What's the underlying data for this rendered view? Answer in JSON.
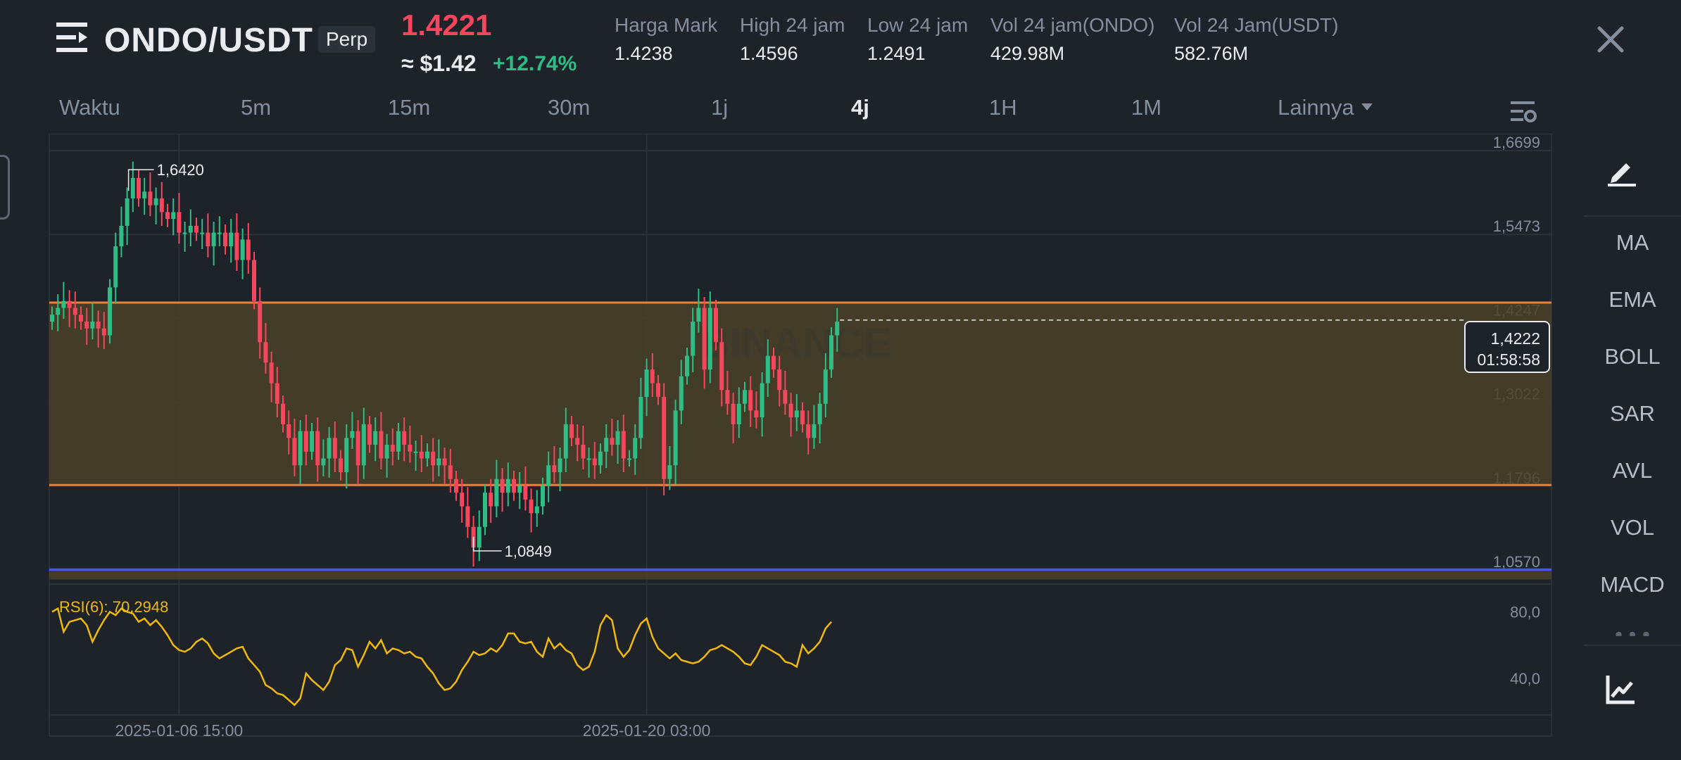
{
  "header": {
    "pair": "ONDO/USDT",
    "badge": "Perp",
    "last_price": "1.4221",
    "usd_price": "≈ $1.42",
    "change": "+12.74%",
    "stats": [
      {
        "label": "Harga Mark",
        "value": "1.4238"
      },
      {
        "label": "High 24 jam",
        "value": "1.4596"
      },
      {
        "label": "Low 24 jam",
        "value": "1.2491"
      },
      {
        "label": "Vol 24 jam(ONDO)",
        "value": "429.98M"
      },
      {
        "label": "Vol 24 Jam(USDT)",
        "value": "582.76M"
      }
    ]
  },
  "tabs": [
    "Waktu",
    "5m",
    "15m",
    "30m",
    "1j",
    "4j",
    "1H",
    "1M",
    "Lainnya"
  ],
  "active_tab": "4j",
  "toolbar": {
    "indicators": [
      "MA",
      "EMA",
      "BOLL",
      "SAR",
      "AVL",
      "VOL",
      "MACD"
    ],
    "icons": [
      "edit-draw-icon",
      "chart-trend-icon"
    ]
  },
  "colors": {
    "up": "#2ebd85",
    "down": "#f6465d",
    "rsi": "#f0b90b",
    "zone_line": "#e8823a",
    "support_line": "#4a5bd6",
    "zone_fill": "#4a4128"
  },
  "chart_data": {
    "type": "candlestick",
    "interval": "4j",
    "watermark": "BINANCE",
    "y_axis_labels": [
      "1,6699",
      "1,5473",
      "1,4247",
      "1,3022",
      "1,1796",
      "1,0570"
    ],
    "ylim": [
      1.057,
      1.6699
    ],
    "x_axis_labels": [
      {
        "label": "2025-01-06 15:00",
        "candle_index": 22
      },
      {
        "label": "2025-01-20 03:00",
        "candle_index": 103
      }
    ],
    "high_marker": {
      "label": "1,6420",
      "value": 1.642
    },
    "low_marker": {
      "label": "1,0849",
      "value": 1.0849
    },
    "current_price": {
      "label": "1,4222",
      "countdown": "01:58:58",
      "value": 1.4222
    },
    "horizontal_lines": [
      {
        "value": 1.4478,
        "role": "zone-top"
      },
      {
        "value": 1.1812,
        "role": "zone-bottom"
      },
      {
        "value": 1.0575,
        "role": "support"
      }
    ],
    "candles_close": [
      1.43,
      1.44,
      1.45,
      1.44,
      1.43,
      1.42,
      1.41,
      1.42,
      1.41,
      1.4,
      1.47,
      1.53,
      1.56,
      1.6,
      1.63,
      1.6,
      1.61,
      1.59,
      1.6,
      1.58,
      1.57,
      1.58,
      1.55,
      1.55,
      1.56,
      1.55,
      1.55,
      1.53,
      1.55,
      1.55,
      1.53,
      1.55,
      1.51,
      1.54,
      1.51,
      1.45,
      1.39,
      1.36,
      1.33,
      1.3,
      1.27,
      1.25,
      1.21,
      1.26,
      1.23,
      1.26,
      1.21,
      1.22,
      1.25,
      1.22,
      1.2,
      1.25,
      1.26,
      1.21,
      1.27,
      1.24,
      1.26,
      1.22,
      1.24,
      1.23,
      1.26,
      1.24,
      1.23,
      1.23,
      1.22,
      1.23,
      1.21,
      1.22,
      1.21,
      1.19,
      1.17,
      1.15,
      1.12,
      1.09,
      1.12,
      1.17,
      1.15,
      1.19,
      1.17,
      1.19,
      1.17,
      1.18,
      1.16,
      1.14,
      1.15,
      1.18,
      1.21,
      1.2,
      1.22,
      1.27,
      1.25,
      1.24,
      1.22,
      1.22,
      1.21,
      1.23,
      1.25,
      1.24,
      1.26,
      1.22,
      1.22,
      1.25,
      1.31,
      1.35,
      1.33,
      1.31,
      1.19,
      1.21,
      1.29,
      1.34,
      1.37,
      1.42,
      1.44,
      1.35,
      1.44,
      1.39,
      1.32,
      1.3,
      1.27,
      1.3,
      1.32,
      1.29,
      1.28,
      1.33,
      1.37,
      1.35,
      1.32,
      1.3,
      1.28,
      1.29,
      1.27,
      1.25,
      1.27,
      1.3,
      1.35,
      1.4,
      1.42
    ],
    "rsi": {
      "label": "RSI(6): 70,2948",
      "value": 70.2948,
      "y_axis_labels": [
        "80,0",
        "40,0"
      ],
      "ylim": [
        18,
        95
      ],
      "values": [
        80,
        82,
        68,
        74,
        75,
        76,
        72,
        62,
        69,
        75,
        80,
        78,
        82,
        80,
        79,
        74,
        76,
        72,
        75,
        71,
        66,
        60,
        57,
        56,
        58,
        62,
        64,
        61,
        55,
        52,
        54,
        56,
        58,
        59,
        52,
        48,
        44,
        36,
        34,
        31,
        30,
        27,
        24,
        28,
        43,
        39,
        36,
        33,
        38,
        48,
        51,
        58,
        57,
        47,
        54,
        62,
        58,
        63,
        55,
        58,
        57,
        55,
        56,
        53,
        52,
        47,
        43,
        37,
        33,
        34,
        38,
        45,
        50,
        56,
        54,
        55,
        58,
        56,
        60,
        67,
        67,
        62,
        61,
        62,
        56,
        53,
        64,
        58,
        61,
        57,
        55,
        48,
        45,
        47,
        56,
        72,
        78,
        75,
        58,
        53,
        57,
        66,
        73,
        76,
        65,
        58,
        55,
        52,
        55,
        51,
        50,
        49,
        50,
        53,
        57,
        58,
        60,
        58,
        56,
        53,
        49,
        48,
        53,
        60,
        58,
        56,
        54,
        50,
        49,
        47,
        60,
        55,
        58,
        62,
        70,
        74
      ]
    }
  }
}
